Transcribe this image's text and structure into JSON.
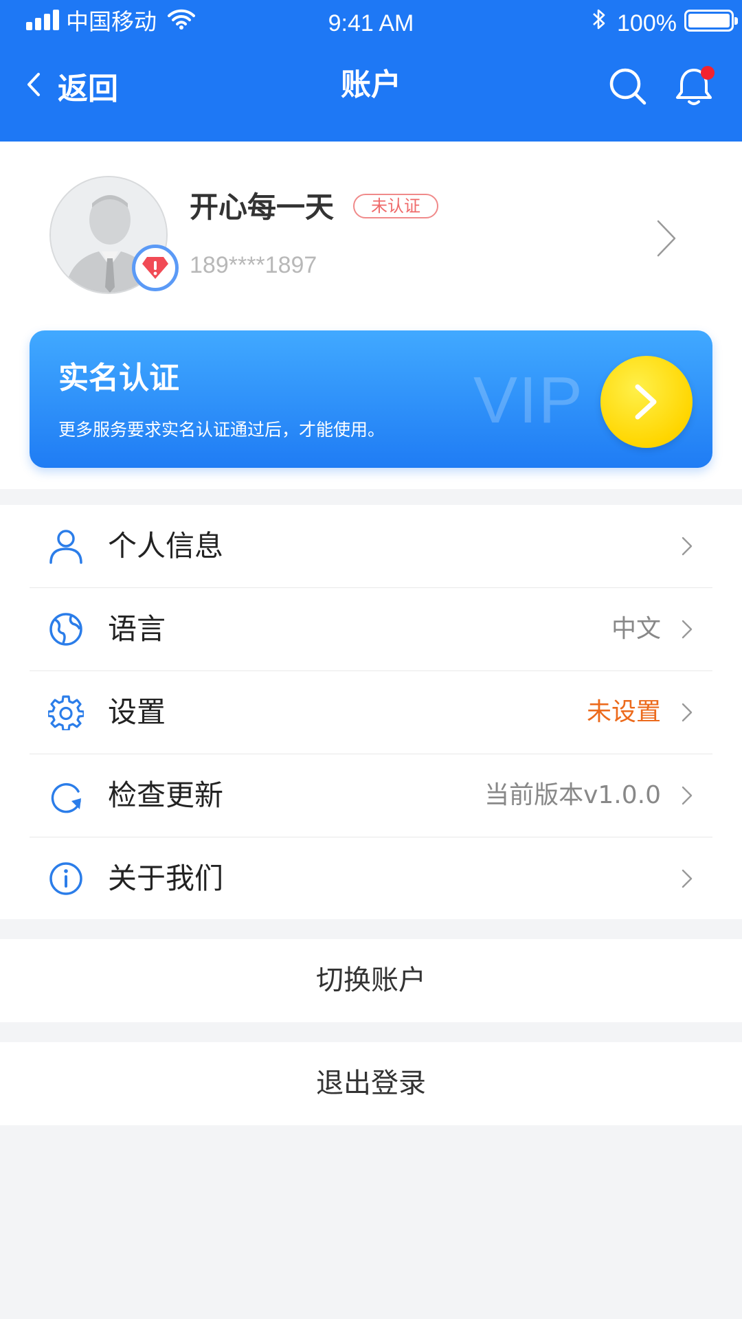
{
  "status_bar": {
    "carrier": "中国移动",
    "time": "9:41 AM",
    "battery": "100%",
    "battery_level": 1.0
  },
  "nav": {
    "back_label": "返回",
    "title": "账户"
  },
  "profile": {
    "name": "开心每一天",
    "verify_tag": "未认证",
    "phone": "189****1897"
  },
  "vip": {
    "title": "实名认证",
    "subtitle": "更多服务要求实名认证通过后，才能使用。",
    "watermark": "VIP"
  },
  "menu": [
    {
      "label": "个人信息",
      "value": "",
      "icon": "user-icon"
    },
    {
      "label": "语言",
      "value": "中文",
      "icon": "globe-icon"
    },
    {
      "label": "设置",
      "value": "未设置",
      "icon": "gear-icon"
    },
    {
      "label": "检查更新",
      "value": "当前版本v1.0.0",
      "icon": "refresh-icon"
    },
    {
      "label": "关于我们",
      "value": "",
      "icon": "info-icon"
    }
  ],
  "actions": {
    "switch_account": "切换账户",
    "logout": "退出登录"
  },
  "colors": {
    "brand_blue": "#1e78f5",
    "warning_orange": "#ec6a1c",
    "notification_red": "#f2232f",
    "vip_yellow": "#ffd600"
  }
}
